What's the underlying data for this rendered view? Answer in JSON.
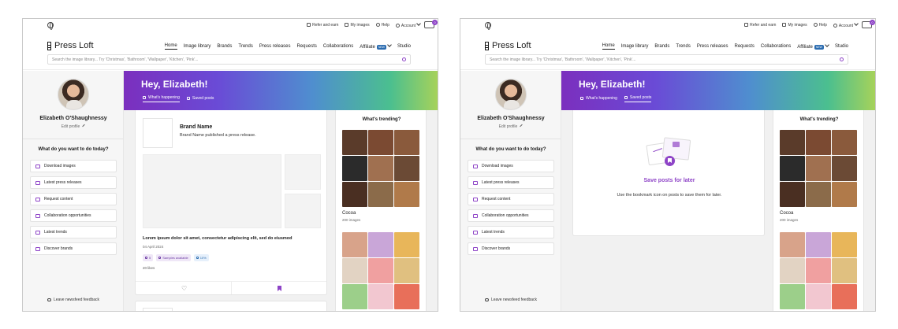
{
  "util": {
    "refer": "Refer and earn",
    "my_images": "My images",
    "help": "Help",
    "account": "Account",
    "cart_count": "0"
  },
  "brand": {
    "name": "Press Loft"
  },
  "nav": {
    "items": [
      "Home",
      "Image library",
      "Brands",
      "Trends",
      "Press releases",
      "Requests",
      "Collaborations"
    ],
    "affiliate": "Affiliate",
    "new_badge": "NEW",
    "studio": "Studio"
  },
  "search": {
    "placeholder": "Search the image library... Try 'Christmas', 'Bathroom', 'Wallpaper', 'Kitchen', 'Pink'..."
  },
  "profile": {
    "name": "Elizabeth O'Shaughnessy",
    "edit": "Edit profile"
  },
  "sidebar": {
    "heading": "What do you want to do today?",
    "actions": [
      "Download images",
      "Latest press releases",
      "Request content",
      "Collaboration opportunities",
      "Latest trends",
      "Discover brands"
    ],
    "feedback": "Leave newsfeed feedback"
  },
  "hero": {
    "greeting": "Hey, Elizabeth!",
    "tab_happening": "What's happening",
    "tab_saved": "Saved posts"
  },
  "post": {
    "brand_name": "Brand Name",
    "brand_sub": "Brand Name published a press release.",
    "title": "Lorem ipsum dolor sit amet, consectetur adipiscing elit, sed do eiusmod",
    "date": "04 April 2024",
    "chip_images": "5",
    "chip_samples": "Samples available",
    "chip_discount": "10%",
    "likes": "20 likes"
  },
  "saved": {
    "title": "Save posts for later",
    "desc": "Use the bookmark icon on posts to save them for later."
  },
  "trending": {
    "heading": "What's trending?",
    "collection_name": "Cocoa",
    "collection_count": "200 images"
  },
  "colors": {
    "accent": "#8e44c7",
    "cocoa_swatches": [
      "#5a3b2a",
      "#7b4a32",
      "#8a5a3c",
      "#2b2b2b",
      "#a07050",
      "#6b4a35",
      "#4a2f22",
      "#8b6b4a",
      "#b07a4a"
    ],
    "pastel_swatches": [
      "#d8a38a",
      "#c9a6d8",
      "#e8b65a",
      "#e2d3c3",
      "#f0a0a0",
      "#e0c080",
      "#9ccf8a",
      "#f2c7d0",
      "#e86f5a"
    ]
  }
}
